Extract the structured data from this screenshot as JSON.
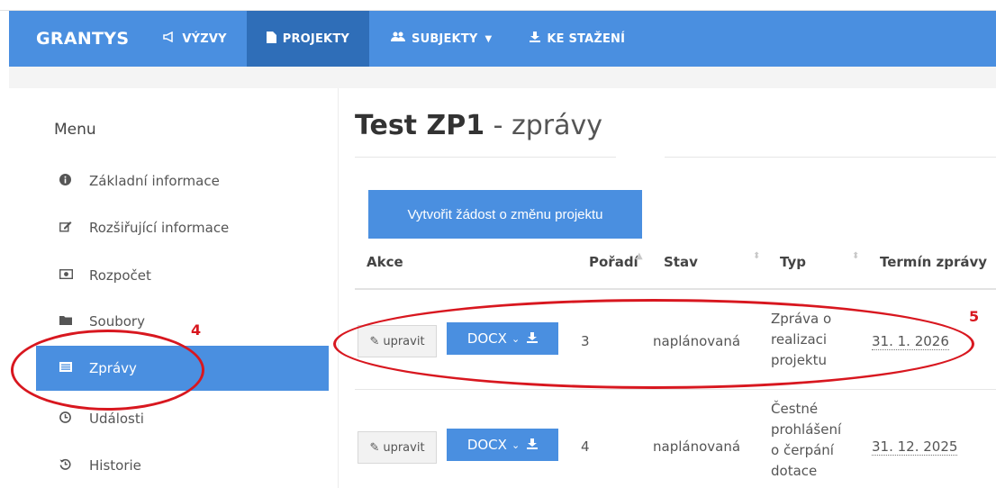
{
  "navbar": {
    "brand": "GRANTYS",
    "items": [
      {
        "label": "VÝZVY",
        "icon": "megaphone-icon",
        "active": false
      },
      {
        "label": "PROJEKTY",
        "icon": "file-icon",
        "active": true
      },
      {
        "label": "SUBJEKTY",
        "icon": "users-icon",
        "active": false,
        "dropdown": true
      },
      {
        "label": "KE STAŽENÍ",
        "icon": "download-icon",
        "active": false
      }
    ]
  },
  "sidebar": {
    "title": "Menu",
    "items": [
      {
        "label": "Základní informace",
        "icon": "info-icon"
      },
      {
        "label": "Rozšiřující informace",
        "icon": "edit-icon"
      },
      {
        "label": "Rozpočet",
        "icon": "money-icon"
      },
      {
        "label": "Soubory",
        "icon": "folder-icon"
      },
      {
        "label": "Zprávy",
        "icon": "list-icon",
        "active": true
      },
      {
        "label": "Události",
        "icon": "clock-icon"
      },
      {
        "label": "Historie",
        "icon": "history-icon"
      }
    ]
  },
  "page": {
    "title_bold": "Test ZP1",
    "title_rest": " - zprávy",
    "create_button": "Vytvořit žádost o změnu projektu"
  },
  "table": {
    "headers": {
      "akce": "Akce",
      "poradi": "Pořadí",
      "stav": "Stav",
      "typ": "Typ",
      "termin": "Termín zprávy"
    },
    "rows": [
      {
        "edit_label": "upravit",
        "docx_label": "DOCX",
        "poradi": "3",
        "stav": "naplánovaná",
        "typ": "Zpráva o realizaci projektu",
        "termin": "31. 1. 2026"
      },
      {
        "edit_label": "upravit",
        "docx_label": "DOCX",
        "poradi": "4",
        "stav": "naplánovaná",
        "typ": "Čestné prohlášení o čerpání dotace",
        "termin": "31. 12. 2025"
      }
    ]
  },
  "annotations": {
    "marker_sidebar": "4",
    "marker_row": "5",
    "color": "#d8171f"
  },
  "colors": {
    "primary": "#4a8fe0",
    "active_nav": "#2f6eb8"
  }
}
